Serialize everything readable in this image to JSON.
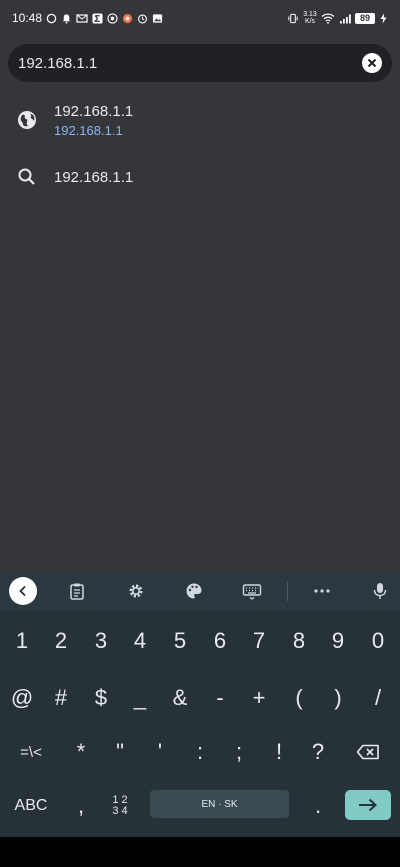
{
  "status_bar": {
    "time": "10:48",
    "network_speed": "3.13 K/s",
    "battery_level": "89"
  },
  "omnibox": {
    "value": "192.168.1.1",
    "clear_icon": "close-circle-icon"
  },
  "suggestions": [
    {
      "icon": "globe-icon",
      "title": "192.168.1.1",
      "url": "192.168.1.1"
    },
    {
      "icon": "search-icon",
      "title": "192.168.1.1"
    }
  ],
  "keyboard": {
    "toolbar": [
      "back-icon",
      "clipboard-icon",
      "gear-icon",
      "palette-icon",
      "keyboard-icon",
      "more-icon",
      "microphone-icon"
    ],
    "row1": [
      "1",
      "2",
      "3",
      "4",
      "5",
      "6",
      "7",
      "8",
      "9",
      "0"
    ],
    "row2": [
      "@",
      "#",
      "$",
      "_",
      "&",
      "-",
      "+",
      "(",
      ")",
      "/"
    ],
    "row3": {
      "mode_key": "=\\<",
      "keys": [
        "*",
        "\"",
        "'",
        ":",
        ";",
        "!",
        "?"
      ],
      "delete_icon": "backspace-icon"
    },
    "row4": {
      "abc_key": "ABC",
      "comma": ",",
      "numpad_top": "1 2",
      "numpad_bottom": "3 4",
      "space_label": "EN · SK",
      "period": ".",
      "enter_icon": "arrow-right-icon"
    }
  },
  "colors": {
    "background": "#35363a",
    "omnibox": "#202124",
    "link": "#8ab4f8",
    "keyboard": "#263238",
    "enter": "#80cbc4"
  }
}
